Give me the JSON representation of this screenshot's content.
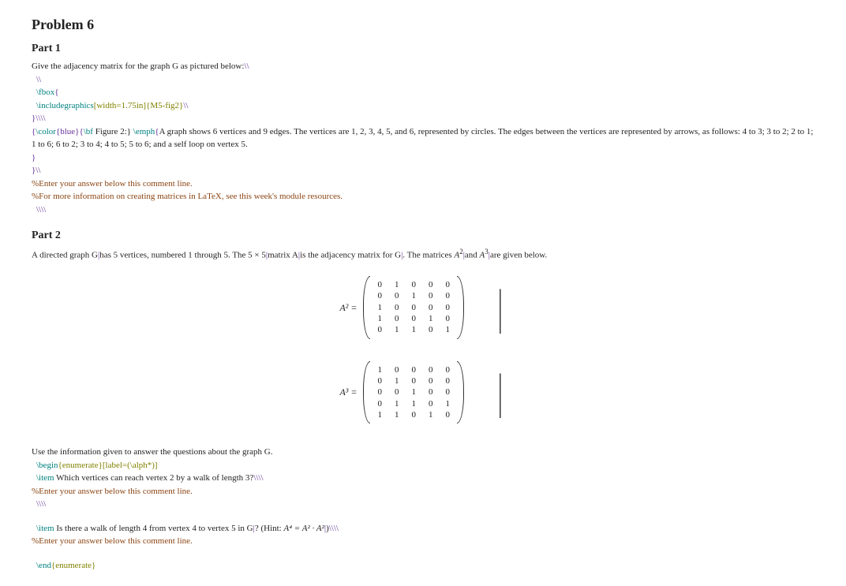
{
  "problem_title": "Problem 6",
  "part1": {
    "heading": "Part 1",
    "intro": "Give the adjacency matrix for the graph G as pictured below:",
    "bs1": "\\\\",
    "bs2": "\\\\",
    "fbox": "\\fbox",
    "brace_open": "{",
    "includegraphics": "\\includegraphics",
    "include_args": "[width=1.75in]{M5-fig2}",
    "bs3": "\\\\",
    "brace_close_bs": "}\\\\\\\\",
    "color_open": "{",
    "color_cmd": "\\color",
    "color_arg": "{blue}{",
    "bf": "\\bf",
    "fig_label": " Figure 2:} ",
    "emph": "\\emph",
    "emph_open": "{",
    "fig_desc": "A graph shows 6 vertices and 9 edges. The vertices are 1, 2, 3, 4, 5, and 6, represented by circles. The edges between the vertices are represented by arrows, as follows: 4 to 3; 3 to 2; 2 to 1; 1 to 6; 6 to 2; 3 to 4; 4 to 5; 5 to 6; and a self loop on vertex 5.",
    "close1": "}",
    "close2": "}\\\\",
    "comment1": "%Enter your answer below this comment line.",
    "comment2": "%For more information on creating matrices in LaTeX, see this week's module resources.",
    "trailing_bs": " \\\\\\\\"
  },
  "part2": {
    "heading": "Part 2",
    "intro_a": "A directed graph G",
    "intro_b": "has 5 vertices, numbered 1 through 5. The 5 × 5",
    "intro_c": "matrix A",
    "intro_d": "is the adjacency matrix for G",
    "intro_e": ". The matrices ",
    "a2": "A",
    "a2sup": "2",
    "intro_f": "and ",
    "a3": "A",
    "a3sup": "3",
    "intro_g": "are given below.",
    "pipe_sep": "|",
    "eq_a2_label": "A² =",
    "eq_a3_label": "A³ =",
    "closing": "Use the information given to answer the questions about the graph G.",
    "begin_enum": "\\begin",
    "begin_enum_args": "{enumerate}[label=(\\alph*)]",
    "item": "\\item",
    "item1_text": " Which vertices can reach vertex 2 by a walk of length 3?",
    "item1_bs": "\\\\\\\\",
    "comment_ans": "%Enter your answer below this comment line.",
    "mid_bs": " \\\\\\\\",
    "item2_a": " Is there a walk of length 4 from vertex 4 to vertex 5 in G",
    "item2_b": "? (Hint: ",
    "hint_eq": "A⁴ = A² · A²",
    "item2_c": ")",
    "item2_bs": "\\\\\\\\",
    "end_enum": "\\end",
    "end_enum_args": "{enumerate}"
  },
  "chart_data": [
    {
      "type": "table",
      "title": "A²",
      "rows": [
        [
          0,
          1,
          0,
          0,
          0
        ],
        [
          0,
          0,
          1,
          0,
          0
        ],
        [
          1,
          0,
          0,
          0,
          0
        ],
        [
          1,
          0,
          0,
          1,
          0
        ],
        [
          0,
          1,
          1,
          0,
          1
        ]
      ]
    },
    {
      "type": "table",
      "title": "A³",
      "rows": [
        [
          1,
          0,
          0,
          0,
          0
        ],
        [
          0,
          1,
          0,
          0,
          0
        ],
        [
          0,
          0,
          1,
          0,
          0
        ],
        [
          0,
          1,
          1,
          0,
          1
        ],
        [
          1,
          1,
          0,
          1,
          0
        ]
      ]
    }
  ]
}
